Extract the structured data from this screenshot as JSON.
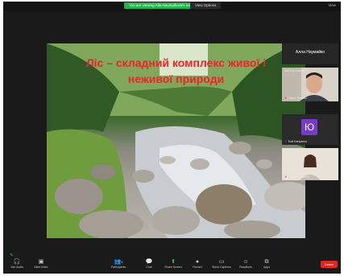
{
  "top_bar": {
    "share_banner": "You are viewing Alla Naumaikova's screen",
    "view_options": "View Options",
    "view_button": "View"
  },
  "slide": {
    "title_line1": "Ліс – складний комплекс живої і",
    "title_line2": "неживої природи"
  },
  "participants": {
    "host_name": "Алла Наумайко",
    "tile1_top_label": "Alla Naumaikova",
    "tile1_name": "Павло Франко",
    "tile2_initial": "Ю",
    "tile2_name": "Yurii Kartyanko",
    "tile3_name": "Карина Чепурна"
  },
  "toolbar": {
    "audio": "Join Audio",
    "video": "Start Video",
    "participants": "Participants",
    "participants_count": "4",
    "chat": "Chat",
    "share": "Share Screen",
    "record": "Record",
    "captions": "Show Captions",
    "reactions": "Reactions",
    "apps": "Apps",
    "end": "Leave"
  },
  "colors": {
    "share_green": "#22b34a",
    "end_red": "#e02828",
    "title_red": "#e8262a",
    "avatar_purple": "#7a3ac8"
  }
}
